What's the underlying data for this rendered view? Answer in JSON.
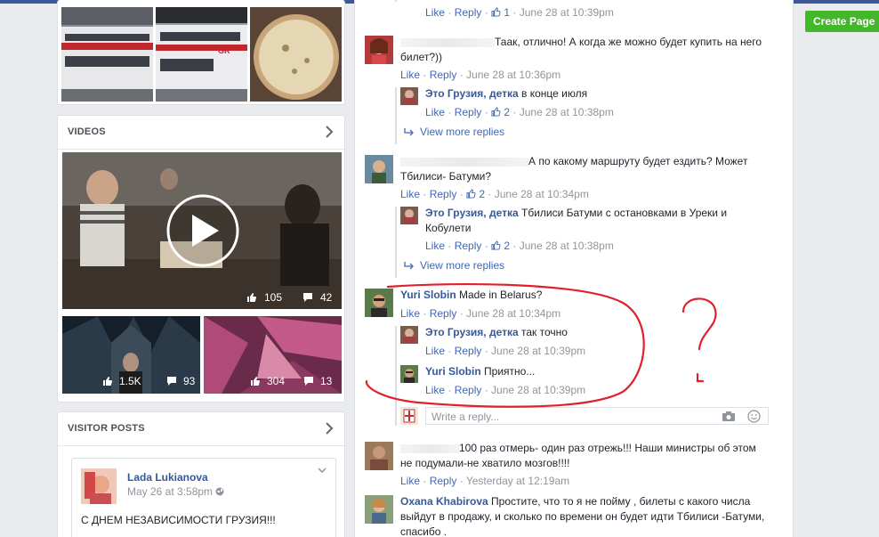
{
  "sidebar": {
    "videos": {
      "title": "VIDEOS",
      "main_video": {
        "likes": "105",
        "comments": "42"
      },
      "small_videos": [
        {
          "likes": "1.5K",
          "comments": "93"
        },
        {
          "likes": "304",
          "comments": "13"
        }
      ]
    },
    "visitor_posts": {
      "title": "VISITOR POSTS",
      "post": {
        "author": "Lada Lukianova",
        "date": "May 26 at 3:58pm",
        "text": "С ДНЕМ НЕЗАВИСИМОСТИ ГРУЗИЯ!!!"
      }
    }
  },
  "actions": {
    "like": "Like",
    "reply": "Reply",
    "view_more_replies": "View more replies"
  },
  "comments": {
    "c0": {
      "likes": "1",
      "time": "June 28 at 10:39pm"
    },
    "c1": {
      "name_hidden": "К...",
      "text_l1": "Таак, отлично! А когда же можно будет купить на него",
      "text_l2": "билет?))",
      "time": "June 28 at 10:36pm"
    },
    "c1r1": {
      "author": "Это Грузия, детка",
      "text": "в конце июля",
      "likes": "2",
      "time": "June 28 at 10:38pm"
    },
    "c2": {
      "text_l1": "А по какому маршруту будет ездить? Может",
      "text_l2": "Тбилиси- Батуми?",
      "likes": "2",
      "time": "June 28 at 10:34pm"
    },
    "c2r1": {
      "author": "Это Грузия, детка",
      "text_l1": "Тбилиси Батуми с остановками в Уреки и",
      "text_l2": "Кобулети",
      "likes": "2",
      "time": "June 28 at 10:38pm"
    },
    "c3": {
      "author": "Yuri Slobin",
      "text": "Made in Belarus?",
      "time": "June 28 at 10:34pm"
    },
    "c3r1": {
      "author": "Это Грузия, детка",
      "text": "так точно",
      "time": "June 28 at 10:39pm"
    },
    "c3r2": {
      "author": "Yuri Slobin",
      "text": "Приятно...",
      "time": "June 28 at 10:39pm"
    },
    "reply_placeholder": "Write a reply...",
    "c4": {
      "text_l1": "100 раз отмерь- один раз отрежь!!! Наши министры об этом",
      "text_l2": "не подумали-не хватило мозгов!!!!",
      "time": "Yesterday at 12:19am"
    },
    "c5": {
      "author": "Oxana Khabirova",
      "text_l1": "Простите, что то я не пойму , билеты с какого числа",
      "text_l2": "выйдут в продажу, и сколько по времени он будет идти Тбилиси -Батуми,",
      "text_l3": "спасибо ."
    }
  },
  "right": {
    "create_page": "Create Page"
  },
  "colors": {
    "fb_blue": "#4267b2",
    "name_blue": "#365899",
    "green": "#42b72a",
    "annotation_red": "#e0202a"
  }
}
